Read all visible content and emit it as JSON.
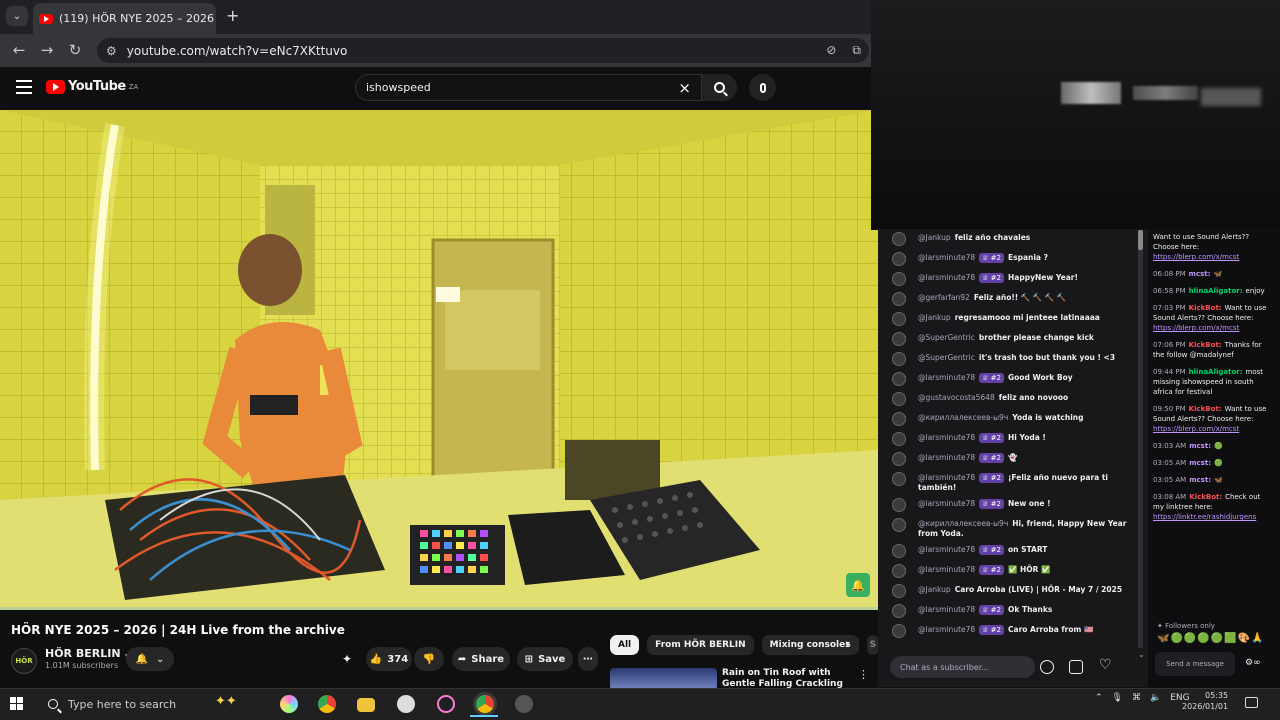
{
  "browser": {
    "tab_title": "(119) HÖR NYE 2025 – 2026",
    "tab_close": "×",
    "new_tab": "+",
    "url": "youtube.com/watch?v=eNc7XKttuvo"
  },
  "youtube": {
    "logo_text": "YouTube",
    "country_code": "ZA",
    "search_value": "ishowspeed",
    "search_clear": "×"
  },
  "video": {
    "title": "HÖR NYE 2025 – 2026 | 24H Live from the archive",
    "channel_logo": "HÖR",
    "channel_name": "HÖR BERLIN",
    "subscribers": "1.01M subscribers",
    "likes": "374",
    "share_label": "Share",
    "save_label": "Save"
  },
  "chips": [
    "All",
    "From HÖR BERLIN",
    "Mixing consoles",
    "S"
  ],
  "recommendation": {
    "title": "Rain on Tin Roof with Gentle Falling Crackling | Relax, Sleep"
  },
  "chat_main": {
    "messages": [
      {
        "user": "@Jankup",
        "badge": "",
        "text": "feliz año chavales"
      },
      {
        "user": "@larsminute78",
        "badge": "♕ #2",
        "text": "Espania ?"
      },
      {
        "user": "@larsminute78",
        "badge": "♕ #2",
        "text": "HappyNew Year!"
      },
      {
        "user": "@gerfarfan92",
        "badge": "",
        "text": "Feliz año!! 🔨 🔨 🔨 🔨"
      },
      {
        "user": "@Jankup",
        "badge": "",
        "text": "regresamooo mi jenteee latinaaaa"
      },
      {
        "user": "@SuperGentric",
        "badge": "",
        "text": "brother please change kick"
      },
      {
        "user": "@SuperGentric",
        "badge": "",
        "text": "it's trash too but thank you ! <3"
      },
      {
        "user": "@larsminute78",
        "badge": "♕ #2",
        "text": "Good Work Boy"
      },
      {
        "user": "@gustavocosta5648",
        "badge": "",
        "text": "feliz ano novooo"
      },
      {
        "user": "@кириллалексеев-ы9ч",
        "badge": "",
        "text": "Yoda is watching"
      },
      {
        "user": "@larsminute78",
        "badge": "♕ #2",
        "text": "Hi Yoda !"
      },
      {
        "user": "@larsminute78",
        "badge": "♕ #2",
        "text": "👻"
      },
      {
        "user": "@larsminute78",
        "badge": "♕ #2",
        "text": "¡Feliz año nuevo para ti también!"
      },
      {
        "user": "@larsminute78",
        "badge": "♕ #2",
        "text": "New one !"
      },
      {
        "user": "@кириллалексеев-ы9ч",
        "badge": "",
        "text": "Hi, friend, Happy New Year from Yoda."
      },
      {
        "user": "@larsminute78",
        "badge": "♕ #2",
        "text": "on START"
      },
      {
        "user": "@larsminute78",
        "badge": "♕ #2",
        "text": "✅ HÖR ✅"
      },
      {
        "user": "@Jankup",
        "badge": "",
        "text": "Caro Arroba (LIVE) | HÖR - May 7 / 2025"
      },
      {
        "user": "@larsminute78",
        "badge": "♕ #2",
        "text": "Ok Thanks"
      },
      {
        "user": "@larsminute78",
        "badge": "♕ #2",
        "text": "Caro Arroba from 🇺🇸"
      }
    ],
    "input_placeholder": "Chat as a subscriber..."
  },
  "chat_side": {
    "messages": [
      {
        "time": "",
        "user": "",
        "color": "",
        "text": "Want to use Sound Alerts?? Choose here:",
        "link": "https://blerp.com/x/mcst"
      },
      {
        "time": "06:08 PM",
        "user": "mcst:",
        "color": "#bf94ff",
        "text": "🦋",
        "link": ""
      },
      {
        "time": "06:58 PM",
        "user": "hlinaAligator:",
        "color": "#00d26a",
        "text": "enjoy",
        "link": ""
      },
      {
        "time": "07:03 PM",
        "user": "KickBot:",
        "color": "#ff4f4f",
        "text": "Want to use Sound Alerts?? Choose here:",
        "link": "https://blerp.com/x/mcst"
      },
      {
        "time": "07:06 PM",
        "user": "KickBot:",
        "color": "#ff4f4f",
        "text": "Thanks for the follow @madalynef",
        "link": ""
      },
      {
        "time": "09:44 PM",
        "user": "hlinaAligator:",
        "color": "#00d26a",
        "text": "most missing ishowspeed in south africa for festival",
        "link": ""
      },
      {
        "time": "09:50 PM",
        "user": "KickBot:",
        "color": "#ff4f4f",
        "text": "Want to use Sound Alerts?? Choose here:",
        "link": "https://blerp.com/x/mcst"
      },
      {
        "time": "03:03 AM",
        "user": "mcst:",
        "color": "#bf94ff",
        "text": "🟢",
        "link": ""
      },
      {
        "time": "03:05 AM",
        "user": "mcst:",
        "color": "#bf94ff",
        "text": "🟢",
        "link": ""
      },
      {
        "time": "03:05 AM",
        "user": "mcst:",
        "color": "#bf94ff",
        "text": "🦋",
        "link": ""
      },
      {
        "time": "03:08 AM",
        "user": "KickBot:",
        "color": "#ff4f4f",
        "text": "Check out my linktree here:",
        "link": "https://linktr.ee/rashidjurgens"
      }
    ],
    "followers_only": "Followers only",
    "emotes": "🦋🟢🟢🟢🟢🟩🎨🙏",
    "input_placeholder": "Send a message"
  },
  "taskbar": {
    "search_placeholder": "Type here to search",
    "language": "ENG",
    "time": "05:35",
    "date": "2026/01/01"
  }
}
